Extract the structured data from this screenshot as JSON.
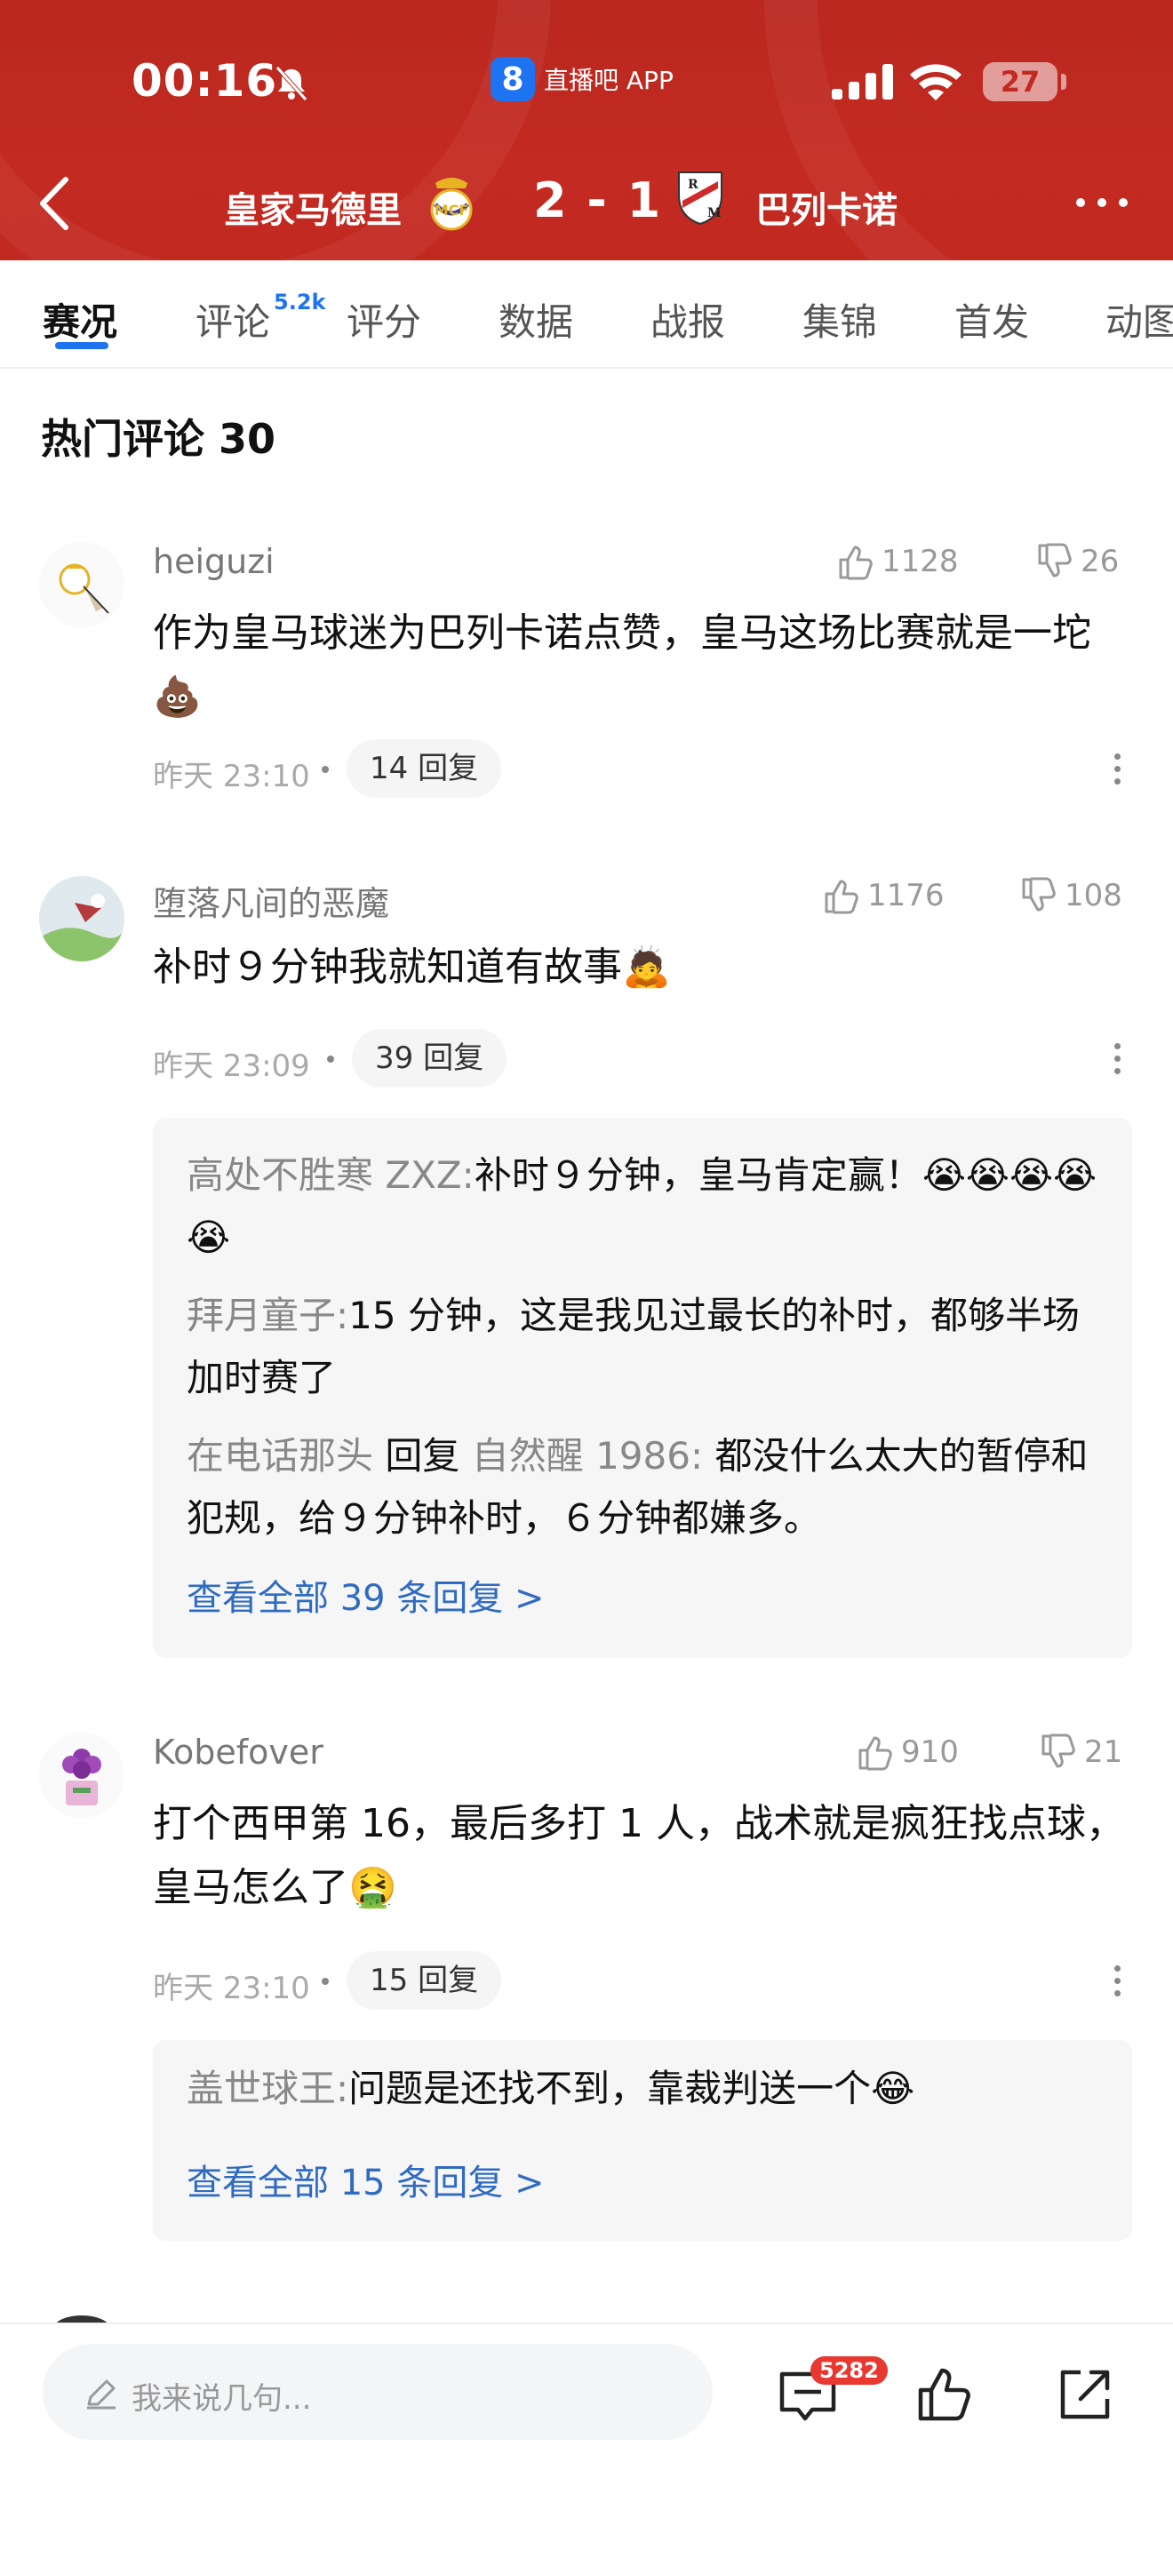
{
  "status": {
    "time": "00:16",
    "app_name": "直播吧 APP",
    "app_logo": "8",
    "battery": "27"
  },
  "match": {
    "home": "皇家马德里",
    "score": "2 - 1",
    "away": "巴列卡诺"
  },
  "tabs": [
    {
      "label": "赛况"
    },
    {
      "label": "评论",
      "sup": "5.2k"
    },
    {
      "label": "评分"
    },
    {
      "label": "数据"
    },
    {
      "label": "战报"
    },
    {
      "label": "集锦"
    },
    {
      "label": "首发"
    },
    {
      "label": "动图"
    }
  ],
  "section": {
    "title": "热门评论 30"
  },
  "comments": [
    {
      "user": "heiguzi",
      "likes": "1128",
      "dislikes": "26",
      "text": "作为皇马球迷为巴列卡诺点赞，皇马这场比赛就是一坨💩",
      "time": "昨天 23:10",
      "replies_label": "14 回复"
    },
    {
      "user": "堕落凡间的恶魔",
      "likes": "1176",
      "dislikes": "108",
      "text": "补时９分钟我就知道有故事🙇",
      "time": "昨天 23:09",
      "replies_label": "39 回复",
      "sub_replies": [
        {
          "name": "高处不胜寒 ZXZ:",
          "text": "补时９分钟，皇马肯定赢！😭😭😭😭😭"
        },
        {
          "name": "拜月童子:",
          "text": "15 分钟，这是我见过最长的补时，都够半场加时赛了"
        },
        {
          "name": "在电话那头",
          "mid": " 回复 ",
          "name2": "自然醒 1986:",
          "text": " 都没什么太大的暂停和犯规，给９分钟补时，６分钟都嫌多。"
        }
      ],
      "view_all": "查看全部 39 条回复 >"
    },
    {
      "user": "Kobefover",
      "likes": "910",
      "dislikes": "21",
      "text": "打个西甲第 16，最后多打 1 人，战术就是疯狂找点球，皇马怎么了🤮",
      "time": "昨天 23:10",
      "replies_label": "15 回复",
      "sub_replies": [
        {
          "name": "盖世球王:",
          "text": "问题是还找不到，靠裁判送一个😂"
        }
      ],
      "view_all": "查看全部 15 条回复 >"
    }
  ],
  "bottom": {
    "placeholder": "我来说几句...",
    "comment_count": "5282"
  },
  "colors": {
    "header": "#c32a21",
    "accent": "#1e73f0",
    "link": "#2f6bc1",
    "badge": "#e8382f"
  }
}
